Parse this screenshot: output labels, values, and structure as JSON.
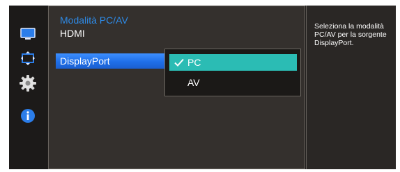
{
  "menu": {
    "title": "Modalità PC/AV",
    "items": [
      {
        "label": "HDMI",
        "selected": false
      },
      {
        "label": "DisplayPort",
        "selected": true
      }
    ]
  },
  "dropdown": {
    "options": [
      {
        "label": "PC",
        "checked": true
      },
      {
        "label": "AV",
        "checked": false
      }
    ]
  },
  "description": "Seleziona la modalità PC/AV per la sorgente DisplayPort.",
  "sidebar_icons": [
    "monitor-icon",
    "picture-size-icon",
    "settings-gear-icon",
    "info-icon"
  ],
  "colors": {
    "title": "#2e8ae6",
    "selected_item": "#1f6fe8",
    "active_option": "#2bbcb4"
  }
}
